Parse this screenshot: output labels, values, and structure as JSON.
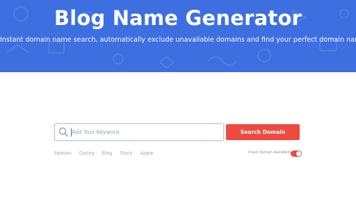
{
  "hero": {
    "title": "Blog Name Generator",
    "subtitle": "Instant domain name search, automatically exclude unavailable domains and find your perfect domain name",
    "background_color": "#3d6fe0"
  },
  "search": {
    "placeholder": "Add Your Keyword",
    "value": "",
    "icon": "search-icon",
    "button_label": "Search Domain",
    "button_color": "#ef4a41"
  },
  "categories": [
    "Fashion",
    "Dating",
    "Blog",
    "Stock",
    "Apple"
  ],
  "availability": {
    "label": "Check Domain Availability",
    "enabled": true,
    "toggle_color": "#ef4a41"
  }
}
